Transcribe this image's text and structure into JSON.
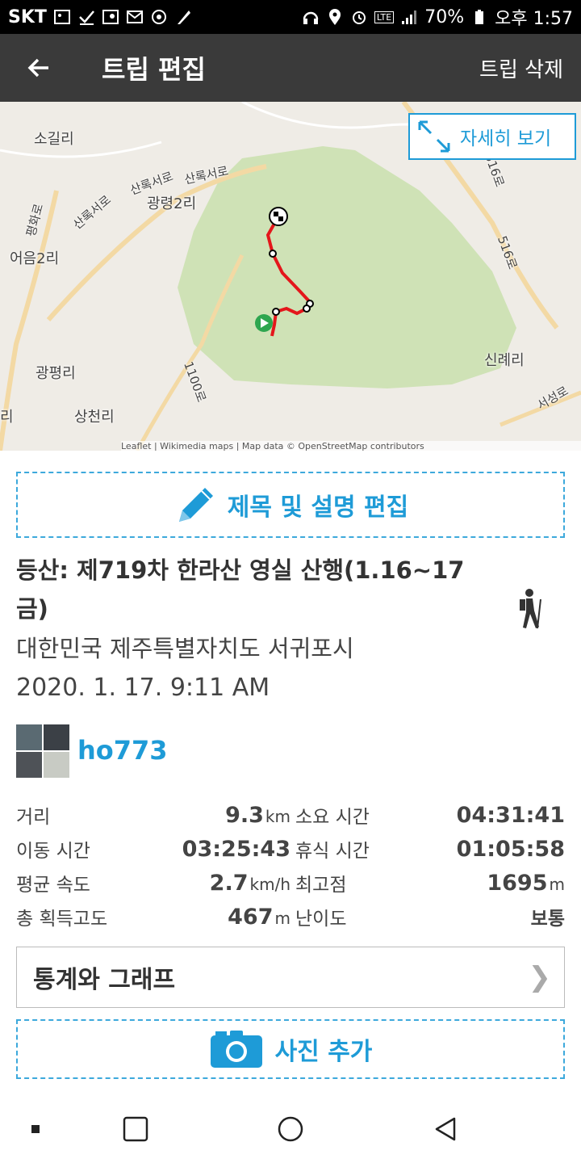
{
  "status_bar": {
    "carrier": "SKT",
    "battery": "70%",
    "time": "오후 1:57",
    "lte": "LTE"
  },
  "app_bar": {
    "title": "트립 편집",
    "delete_label": "트립 삭제"
  },
  "map": {
    "detail_label": "자세히 보기",
    "labels": [
      "소길리",
      "광령2리",
      "어음2리",
      "광평리",
      "상천리",
      "신례리",
      "산록서로",
      "산록서로",
      "산록서로",
      "1100로",
      "516로",
      "516로",
      "평화로",
      "서성로",
      "리"
    ],
    "attribution": "Leaflet | Wikimedia maps | Map data © OpenStreetMap contributors",
    "route_color": "#e4161b",
    "park_color": "#cfe2b6"
  },
  "edit_label": "제목 및 설명 편집",
  "trip": {
    "title": "등산: 제719차 한라산 영실 산행(1.16~17 금)",
    "location": "대한민국 제주특별자치도 서귀포시",
    "datetime": "2020. 1. 17. 9:11 AM",
    "activity_icon": "hiker-icon"
  },
  "user": {
    "name": "ho773"
  },
  "stats": {
    "distance_label": "거리",
    "distance_value": "9.3",
    "distance_unit": "km",
    "duration_label": "소요 시간",
    "duration_value": "04:31:41",
    "moving_label": "이동 시간",
    "moving_value": "03:25:43",
    "rest_label": "휴식 시간",
    "rest_value": "01:05:58",
    "speed_label": "평균 속도",
    "speed_value": "2.7",
    "speed_unit": "km/h",
    "peak_label": "최고점",
    "peak_value": "1695",
    "peak_unit": "m",
    "gain_label": "총 획득고도",
    "gain_value": "467",
    "gain_unit": "m",
    "difficulty_label": "난이도",
    "difficulty_value": "보통"
  },
  "graph_label": "통계와 그래프",
  "graph_chevron": "❯",
  "photo_label": "사진 추가",
  "colors": {
    "accent": "#1e9bd7",
    "app_bar": "#3a3a3a"
  }
}
